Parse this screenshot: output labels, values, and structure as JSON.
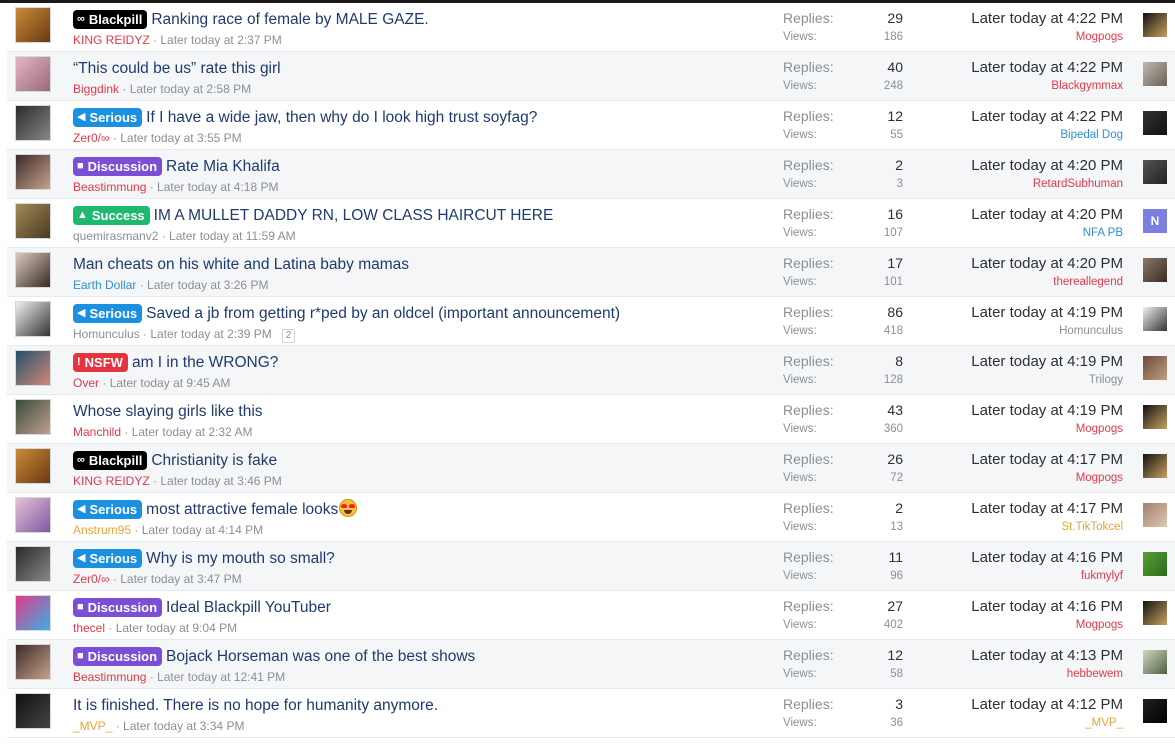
{
  "labels": {
    "replies": "Replies:",
    "views": "Views:"
  },
  "prefix_colors": {
    "Blackpill": "#000000",
    "Serious": "#1b8fe0",
    "Discussion": "#7a4fd6",
    "Success": "#1eb86f",
    "NSFW": "#e2353f"
  },
  "prefix_icons": {
    "Blackpill": "glasses-icon",
    "Serious": "megaphone-icon",
    "Discussion": "comments-icon",
    "Success": "thumbs-up-icon",
    "NSFW": "exclamation-circle-icon"
  },
  "threads": [
    {
      "prefix": "Blackpill",
      "title": "Ranking race of female by MALE GAZE.",
      "author": "KING REIDYZ",
      "author_color": "#e03a4a",
      "started": "Later today at 2:37 PM",
      "replies": "29",
      "views": "186",
      "last_date": "Later today at 4:22 PM",
      "last_user": "Mogpogs",
      "last_user_color": "#e03a4a"
    },
    {
      "prefix": "",
      "title": "“This could be us” rate this girl",
      "author": "Biggdink",
      "author_color": "#e03a4a",
      "started": "Later today at 2:58 PM",
      "replies": "40",
      "views": "248",
      "last_date": "Later today at 4:22 PM",
      "last_user": "Blackgymmax",
      "last_user_color": "#e03a4a"
    },
    {
      "prefix": "Serious",
      "title": "If I have a wide jaw, then why do I look high trust soyfag?",
      "author": "Zer0/∞",
      "author_color": "#e03a4a",
      "started": "Later today at 3:55 PM",
      "replies": "12",
      "views": "55",
      "last_date": "Later today at 4:22 PM",
      "last_user": "Bipedal Dog",
      "last_user_color": "#2f8fd8"
    },
    {
      "prefix": "Discussion",
      "title": "Rate Mia Khalifa",
      "author": "Beastimmung",
      "author_color": "#e03a4a",
      "started": "Later today at 4:18 PM",
      "replies": "2",
      "views": "3",
      "last_date": "Later today at 4:20 PM",
      "last_user": "RetardSubhuman",
      "last_user_color": "#e03a4a"
    },
    {
      "prefix": "Success",
      "title": "IM A MULLET DADDY RN, LOW CLASS HAIRCUT HERE",
      "author": "quemirasmanv2",
      "author_color": "#8a8f97",
      "started": "Later today at 11:59 AM",
      "replies": "16",
      "views": "107",
      "last_date": "Later today at 4:20 PM",
      "last_user": "NFA PB",
      "last_user_color": "#2f8fd8",
      "last_letter": "N"
    },
    {
      "prefix": "",
      "title": "Man cheats on his white and Latina baby mamas",
      "author": "Earth Dollar",
      "author_color": "#2f8fd8",
      "started": "Later today at 3:26 PM",
      "replies": "17",
      "views": "101",
      "last_date": "Later today at 4:20 PM",
      "last_user": "thereallegend",
      "last_user_color": "#e03a4a"
    },
    {
      "prefix": "Serious",
      "title": "Saved a jb from getting r*ped by an oldcel (important announcement)",
      "author": "Homunculus",
      "author_color": "#8a8f97",
      "started": "Later today at 2:39 PM",
      "page": "2",
      "replies": "86",
      "views": "418",
      "last_date": "Later today at 4:19 PM",
      "last_user": "Homunculus",
      "last_user_color": "#8a8f97"
    },
    {
      "prefix": "NSFW",
      "title": "am I in the WRONG?",
      "author": "Over",
      "author_color": "#e03a4a",
      "started": "Later today at 9:45 AM",
      "replies": "8",
      "views": "128",
      "last_date": "Later today at 4:19 PM",
      "last_user": "Trilogy",
      "last_user_color": "#8a8f97"
    },
    {
      "prefix": "",
      "title": "Whose slaying girls like this",
      "author": "Manchild",
      "author_color": "#e03a4a",
      "started": "Later today at 2:32 AM",
      "replies": "43",
      "views": "360",
      "last_date": "Later today at 4:19 PM",
      "last_user": "Mogpogs",
      "last_user_color": "#e03a4a"
    },
    {
      "prefix": "Blackpill",
      "title": "Christianity is fake",
      "author": "KING REIDYZ",
      "author_color": "#e03a4a",
      "started": "Later today at 3:46 PM",
      "replies": "26",
      "views": "72",
      "last_date": "Later today at 4:17 PM",
      "last_user": "Mogpogs",
      "last_user_color": "#e03a4a"
    },
    {
      "prefix": "Serious",
      "title": "most attractive female looks",
      "emoji": true,
      "author": "Anstrum95",
      "author_color": "#e8a43a",
      "started": "Later today at 4:14 PM",
      "replies": "2",
      "views": "13",
      "last_date": "Later today at 4:17 PM",
      "last_user": "St.TikTokcel",
      "last_user_color": "#e8a43a"
    },
    {
      "prefix": "Serious",
      "title": "Why is my mouth so small?",
      "author": "Zer0/∞",
      "author_color": "#e03a4a",
      "started": "Later today at 3:47 PM",
      "replies": "11",
      "views": "96",
      "last_date": "Later today at 4:16 PM",
      "last_user": "fukmylyf",
      "last_user_color": "#e03a4a"
    },
    {
      "prefix": "Discussion",
      "title": "Ideal Blackpill YouTuber",
      "author": "thecel",
      "author_color": "#e03a4a",
      "started": "Later today at 9:04 PM",
      "replies": "27",
      "views": "402",
      "last_date": "Later today at 4:16 PM",
      "last_user": "Mogpogs",
      "last_user_color": "#e03a4a"
    },
    {
      "prefix": "Discussion",
      "title": "Bojack Horseman was one of the best shows",
      "author": "Beastimmung",
      "author_color": "#e03a4a",
      "started": "Later today at 12:41 PM",
      "replies": "12",
      "views": "58",
      "last_date": "Later today at 4:13 PM",
      "last_user": "hebbewem",
      "last_user_color": "#e03a4a"
    },
    {
      "prefix": "",
      "title": "It is finished. There is no hope for humanity anymore.",
      "author": "_MVP_",
      "author_color": "#e8a43a",
      "started": "Later today at 3:34 PM",
      "replies": "3",
      "views": "36",
      "last_date": "Later today at 4:12 PM",
      "last_user": "_MVP_",
      "last_user_color": "#e8a43a"
    }
  ]
}
